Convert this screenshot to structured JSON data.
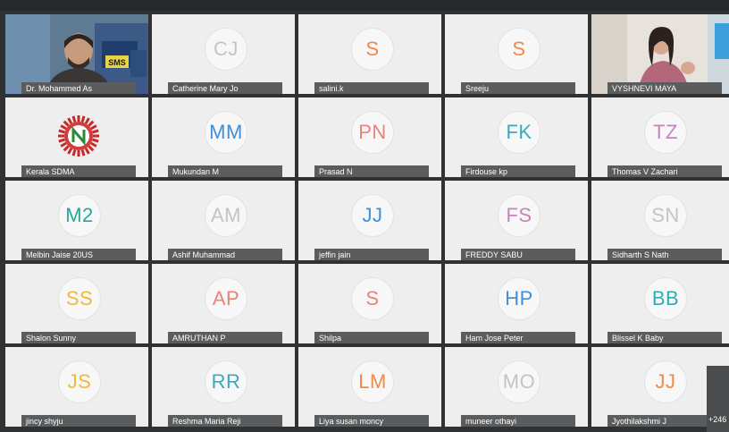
{
  "meeting": {
    "overflow_count": "+246"
  },
  "participants": [
    {
      "name": "Dr. Mohammed As",
      "type": "video",
      "scene": "man"
    },
    {
      "name": "Catherine Mary Jo",
      "initials": "CJ",
      "color": "#c4c4c4"
    },
    {
      "name": "salini.k",
      "initials": "S",
      "color": "#f08a4b"
    },
    {
      "name": "Sreeju",
      "initials": "S",
      "color": "#f08a4b"
    },
    {
      "name": "VYSHNEVI MAYA",
      "type": "video",
      "scene": "woman"
    },
    {
      "name": "Kerala SDMA",
      "type": "logo"
    },
    {
      "name": "Mukundan M",
      "initials": "MM",
      "color": "#3f8fd6"
    },
    {
      "name": "Prasad N",
      "initials": "PN",
      "color": "#e8837a"
    },
    {
      "name": "Firdouse kp",
      "initials": "FK",
      "color": "#3aa9bf"
    },
    {
      "name": "Thomas V Zachari",
      "initials": "TZ",
      "color": "#c784b8"
    },
    {
      "name": "Melbin Jaise 20US",
      "initials": "M2",
      "color": "#2aa699"
    },
    {
      "name": "Ashif Muhammad",
      "initials": "AM",
      "color": "#c4c4c4"
    },
    {
      "name": "jeffin jain",
      "initials": "JJ",
      "color": "#3f8fd6"
    },
    {
      "name": "FREDDY SABU",
      "initials": "FS",
      "color": "#c784b8"
    },
    {
      "name": "Sidharth S Nath",
      "initials": "SN",
      "color": "#c4c4c4"
    },
    {
      "name": "Shalon Sunny",
      "initials": "SS",
      "color": "#f0b93b"
    },
    {
      "name": "AMRUTHAN P",
      "initials": "AP",
      "color": "#e8837a"
    },
    {
      "name": "Shilpa",
      "initials": "S",
      "color": "#e8837a"
    },
    {
      "name": "Ham Jose Peter",
      "initials": "HP",
      "color": "#3f8fd6"
    },
    {
      "name": "Blissel K Baby",
      "initials": "BB",
      "color": "#2ab0b0"
    },
    {
      "name": "jincy shyju",
      "initials": "JS",
      "color": "#f0b93b"
    },
    {
      "name": "Reshma Maria Reji",
      "initials": "RR",
      "color": "#3aa9bf"
    },
    {
      "name": "Liya susan moncy",
      "initials": "LM",
      "color": "#f08a4b"
    },
    {
      "name": "muneer othayi",
      "initials": "MO",
      "color": "#c4c4c4"
    },
    {
      "name": "Jyothilakshmi J",
      "initials": "JJ",
      "color": "#f08a4b"
    }
  ]
}
